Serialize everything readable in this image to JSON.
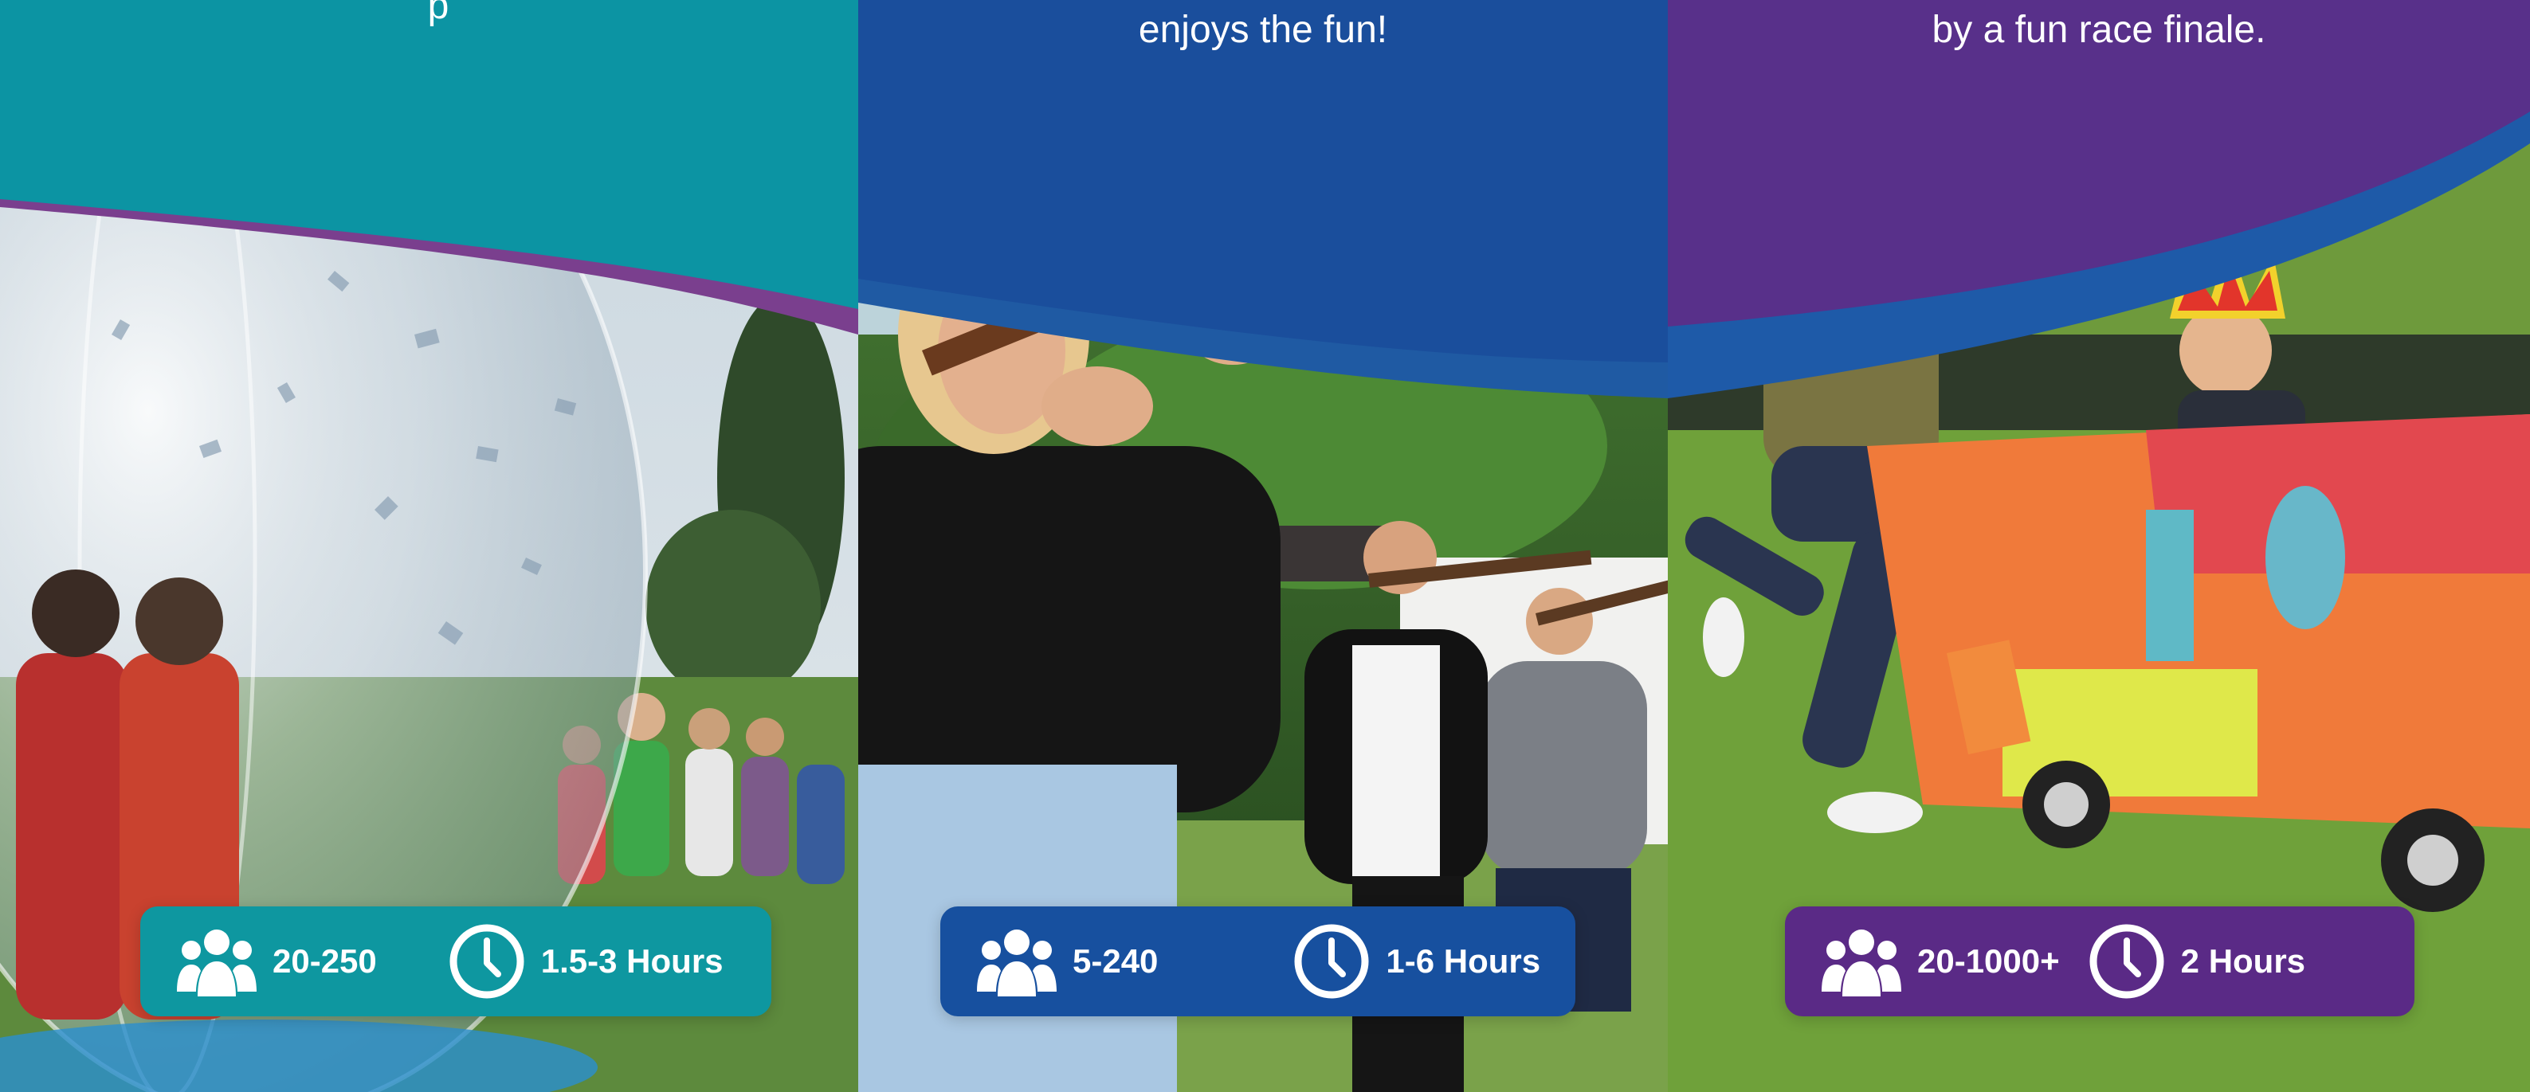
{
  "colors": {
    "teal": "#0e97a0",
    "blue": "#17509f",
    "purple": "#5a2a86",
    "text": "#ffffff"
  },
  "cards": [
    {
      "id": "zorb",
      "tagline": "p",
      "photo": "zorb-ball-confetti-crowd",
      "group_icon": "group-icon",
      "group_size": "20-250",
      "clock_icon": "clock-icon",
      "duration": "1.5-3 Hours"
    },
    {
      "id": "clay-shooting",
      "tagline": "enjoys the fun!",
      "photo": "clay-shooting-shotguns",
      "group_icon": "group-icon",
      "group_size": "5-240",
      "clock_icon": "clock-icon",
      "duration": "1-6 Hours"
    },
    {
      "id": "cart-race",
      "tagline": "by a fun race finale.",
      "photo": "cardboard-cart-race",
      "group_icon": "group-icon",
      "group_size": "20-1000+",
      "clock_icon": "clock-icon",
      "duration": "2 Hours"
    }
  ]
}
